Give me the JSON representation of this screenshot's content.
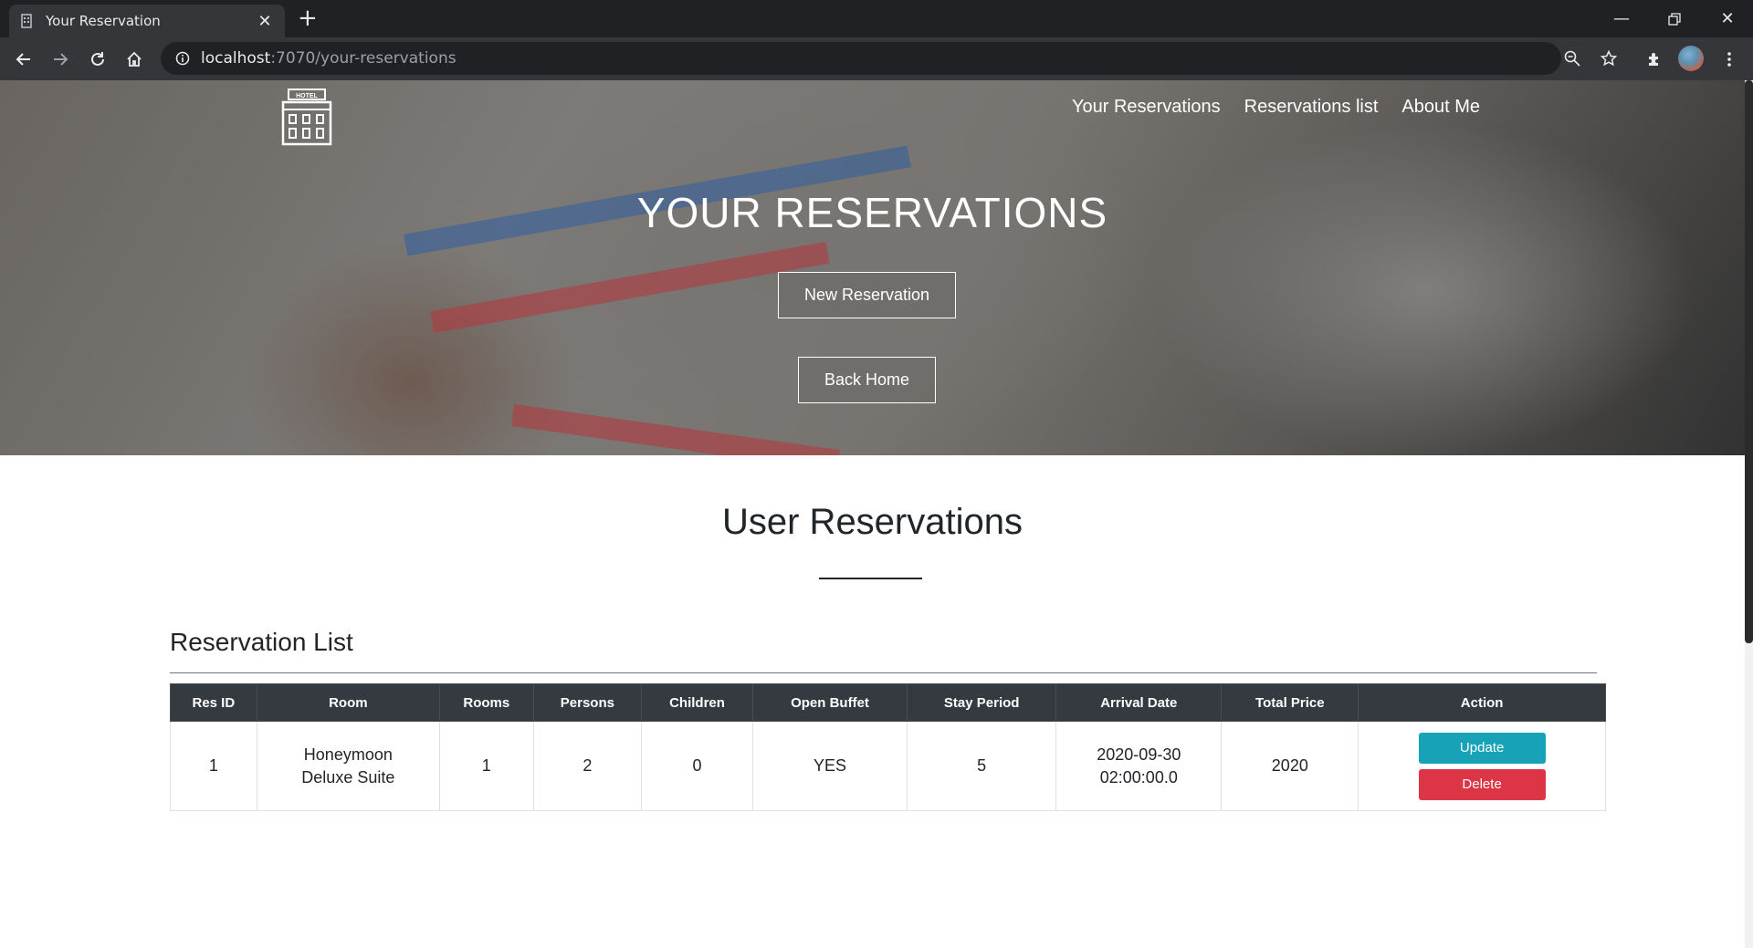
{
  "browser": {
    "tab_title": "Your Reservation",
    "new_tab_symbol": "+",
    "url_host": "localhost",
    "url_path": ":7070/your-reservations",
    "icons": [
      "back-icon",
      "forward-icon",
      "reload-icon",
      "home-icon",
      "info-icon",
      "zoom-icon",
      "star-icon",
      "extensions-icon",
      "menu-icon"
    ]
  },
  "nav": {
    "your_reservations": "Your Reservations",
    "reservations_list": "Reservations list",
    "about_me": "About Me"
  },
  "logo": {
    "text": "HOTEL"
  },
  "hero": {
    "title": "YOUR RESERVATIONS",
    "new_reservation": "New Reservation",
    "back_home": "Back Home"
  },
  "section": {
    "title": "User Reservations",
    "list_title": "Reservation List"
  },
  "table": {
    "headers": [
      "Res ID",
      "Room",
      "Rooms",
      "Persons",
      "Children",
      "Open Buffet",
      "Stay Period",
      "Arrival Date",
      "Total Price",
      "Action"
    ],
    "rows": [
      {
        "res_id": "1",
        "room_line1": "Honeymoon",
        "room_line2": "Deluxe Suite",
        "rooms": "1",
        "persons": "2",
        "children": "0",
        "open_buffet": "YES",
        "stay_period": "5",
        "arrival_line1": "2020-09-30",
        "arrival_line2": "02:00:00.0",
        "total_price": "2020",
        "update_label": "Update",
        "delete_label": "Delete"
      }
    ]
  },
  "colors": {
    "chrome_dark": "#202124",
    "chrome_toolbar": "#35363a",
    "table_header": "#343a40",
    "update": "#17a2b8",
    "delete": "#dc3545"
  }
}
